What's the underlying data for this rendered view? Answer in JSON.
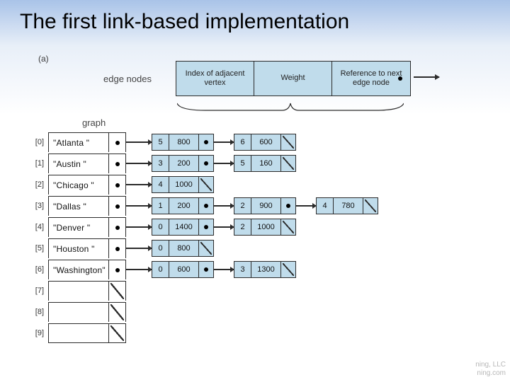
{
  "title": "The first link-based implementation",
  "subfig": "(a)",
  "legend_label": "edge nodes",
  "legend": {
    "col1": "Index of adjacent vertex",
    "col2": "Weight",
    "col3": "Reference to next edge node"
  },
  "graph_label": "graph",
  "vertices": [
    {
      "idx": "[0]",
      "name": "\"Atlanta     \"",
      "edges": [
        {
          "i": "5",
          "w": "800"
        },
        {
          "i": "6",
          "w": "600"
        }
      ]
    },
    {
      "idx": "[1]",
      "name": "\"Austin      \"",
      "edges": [
        {
          "i": "3",
          "w": "200"
        },
        {
          "i": "5",
          "w": "160"
        }
      ]
    },
    {
      "idx": "[2]",
      "name": "\"Chicago     \"",
      "edges": [
        {
          "i": "4",
          "w": "1000"
        }
      ]
    },
    {
      "idx": "[3]",
      "name": "\"Dallas      \"",
      "edges": [
        {
          "i": "1",
          "w": "200"
        },
        {
          "i": "2",
          "w": "900"
        },
        {
          "i": "4",
          "w": "780"
        }
      ]
    },
    {
      "idx": "[4]",
      "name": "\"Denver      \"",
      "edges": [
        {
          "i": "0",
          "w": "1400"
        },
        {
          "i": "2",
          "w": "1000"
        }
      ]
    },
    {
      "idx": "[5]",
      "name": "\"Houston     \"",
      "edges": [
        {
          "i": "0",
          "w": "800"
        }
      ]
    },
    {
      "idx": "[6]",
      "name": "\"Washington\"",
      "edges": [
        {
          "i": "0",
          "w": "600"
        },
        {
          "i": "3",
          "w": "1300"
        }
      ]
    },
    {
      "idx": "[7]",
      "name": "",
      "edges": null
    },
    {
      "idx": "[8]",
      "name": "",
      "edges": null
    },
    {
      "idx": "[9]",
      "name": "",
      "edges": null
    }
  ],
  "watermark": {
    "l1": "ning, LLC",
    "l2": "ning.com"
  }
}
